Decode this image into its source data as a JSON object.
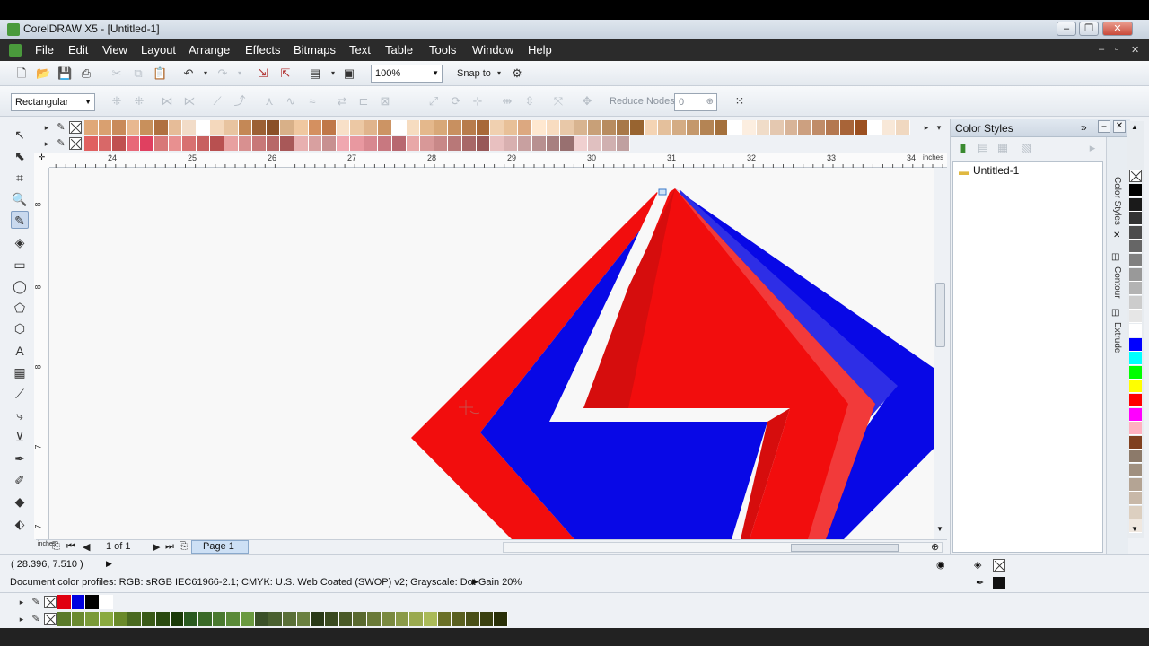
{
  "window": {
    "title": "CorelDRAW X5 - [Untitled-1]"
  },
  "menu": [
    "File",
    "Edit",
    "View",
    "Layout",
    "Arrange",
    "Effects",
    "Bitmaps",
    "Text",
    "Table",
    "Tools",
    "Window",
    "Help"
  ],
  "standard_toolbar": {
    "zoom": "100%",
    "snap_to": "Snap to"
  },
  "property_bar": {
    "selection_mode": "Rectangular",
    "reduce_nodes_label": "Reduce Nodes",
    "reduce_nodes_value": "0"
  },
  "ruler": {
    "h_ticks": [
      "24",
      "25",
      "26",
      "27",
      "28",
      "29",
      "30",
      "31",
      "32",
      "33",
      "34"
    ],
    "h_unit": "inches",
    "v_ticks": [
      "8",
      "8",
      "8",
      "7",
      "7"
    ],
    "v_unit": "inches"
  },
  "page_nav": {
    "page_count": "1 of 1",
    "page_tab": "Page 1"
  },
  "docker": {
    "title": "Color Styles",
    "tree_item": "Untitled-1",
    "tabs": [
      "Color Styles",
      "Contour",
      "Extrude"
    ]
  },
  "status": {
    "coords": "( 28.396, 7.510 )",
    "color_profiles": "Document color profiles: RGB: sRGB IEC61966-2.1; CMYK: U.S. Web Coated (SWOP) v2; Grayscale: Dot Gain 20%"
  },
  "palettes": {
    "row1": [
      "#e0a878",
      "#d9a070",
      "#c98a5a",
      "#e8b890",
      "#c8905c",
      "#b07040",
      "#e6bc98",
      "#f2dcc8",
      "#ffffff",
      "#f4d8bc",
      "#e8c4a0",
      "#c48856",
      "#9c6034",
      "#8a5028",
      "#d8b088",
      "#f0c8a0",
      "#d49060",
      "#c07848",
      "#f8e0c8",
      "#ecc8a4",
      "#e0b48c",
      "#cc9464",
      "#ffffff",
      "#f6dcc0",
      "#e4b88c",
      "#d8a878",
      "#c89060",
      "#b87c4c",
      "#a86838",
      "#f0d0b0",
      "#e8c098",
      "#dca880",
      "#ffe8d0",
      "#f8dcc0",
      "#e8c8a8",
      "#d8b490",
      "#c8a078",
      "#b88c60",
      "#a87848",
      "#986430",
      "#f4d4b4",
      "#e4c09c",
      "#d4ac84",
      "#c4986c",
      "#b48454",
      "#a4703c",
      "#ffffff",
      "#fceee0",
      "#f0dcc8",
      "#e4c8b0",
      "#d8b498",
      "#cca080",
      "#c08c68",
      "#b47850",
      "#a86438",
      "#9c5020",
      "#ffffff",
      "#f8e8d8",
      "#f0d8c0",
      "#e8c8a8",
      "#e0b890",
      "#d8a878",
      "#d09860",
      "#c88848"
    ],
    "row2": [
      "#e06060",
      "#d86868",
      "#c05050",
      "#e86878",
      "#e04060",
      "#d87878",
      "#e89090",
      "#d87070",
      "#c86060",
      "#b85050",
      "#e8a0a0",
      "#d89090",
      "#c87878",
      "#b86868",
      "#a85858",
      "#e8b0b0",
      "#d8a0a0",
      "#c89090",
      "#f0a8b0",
      "#e898a0",
      "#d88890",
      "#c87880",
      "#b86870",
      "#e8a8a8",
      "#d89898",
      "#c88888",
      "#b87878",
      "#a86868",
      "#985858",
      "#e8c0c0",
      "#d8b0b0",
      "#c8a0a0",
      "#b89090",
      "#a88080",
      "#987070",
      "#f0d0d0",
      "#e0c0c0",
      "#d0b0b0",
      "#c0a0a0"
    ],
    "bottom1": [
      "#e00010",
      "#0000e0",
      "#000000",
      "#ffffff"
    ],
    "bottom2": [
      "#5a7a2a",
      "#6a8a30",
      "#7a9a38",
      "#8aaa40",
      "#6a8a2a",
      "#4a6a20",
      "#3a5a18",
      "#2a4a10",
      "#1a3a08",
      "#2a5a20",
      "#3a6a28",
      "#4a7a30",
      "#5a8a38",
      "#6a9a40",
      "#3a5028",
      "#4a6030",
      "#5a7038",
      "#6a8040",
      "#2a3a18",
      "#3a4a20",
      "#4a5a28",
      "#5a6a30",
      "#6a7a38",
      "#7a8a40",
      "#8a9a48",
      "#9aaa50",
      "#aaba58",
      "#6a7028",
      "#5a6020",
      "#4a5018",
      "#3a4010",
      "#2a3008"
    ],
    "right": [
      "#000000",
      "#1a1a1a",
      "#333333",
      "#4d4d4d",
      "#666666",
      "#808080",
      "#999999",
      "#b3b3b3",
      "#cccccc",
      "#e6e6e6",
      "#ffffff",
      "#0000ff",
      "#00ffff",
      "#00ff00",
      "#ffff00",
      "#ff0000",
      "#ff00ff",
      "#ffb0c0",
      "#804020",
      "#8c7a6a",
      "#a09080",
      "#b4a494",
      "#c8b8a8",
      "#dccfc0",
      "#f0e8e0"
    ]
  },
  "colors": {
    "red": "#f20d0d",
    "blue": "#0808e6",
    "dark_red": "#d60d0d",
    "light_red": "#f23a3a",
    "mid_blue": "#2e2ee6"
  }
}
